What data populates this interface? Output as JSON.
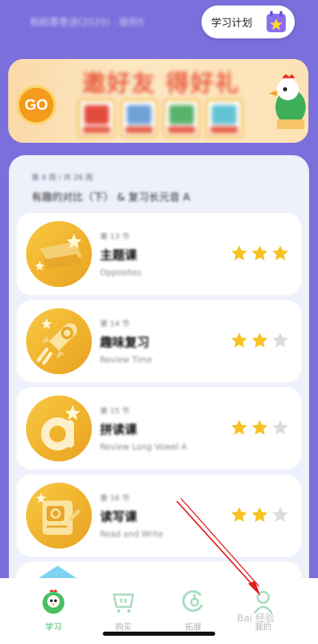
{
  "header": {
    "blurred_text": "稻稻要患迹(2020) · 级别5",
    "plan_button_label": "学习计划"
  },
  "banner": {
    "go_label": "GO",
    "title": "邀好友 得好礼"
  },
  "unit": {
    "meta": "第 4 周 / 共 26 周",
    "title": "有趣的对比（下） & 复习长元音 A"
  },
  "lessons": [
    {
      "index": "第 13 节",
      "title": "主题课",
      "subtitle": "Opposites",
      "stars": 3
    },
    {
      "index": "第 14 节",
      "title": "趣味复习",
      "subtitle": "Review Time",
      "stars": 2
    },
    {
      "index": "第 15 节",
      "title": "拼读课",
      "subtitle": "Review Long Vowel A",
      "stars": 2
    },
    {
      "index": "第 16 节",
      "title": "读写课",
      "subtitle": "Read and Write",
      "stars": 2
    }
  ],
  "nav": {
    "items": [
      {
        "label": "学习",
        "icon": "bird-mascot-icon",
        "active": true
      },
      {
        "label": "购买",
        "icon": "cart-icon",
        "active": false
      },
      {
        "label": "拓展",
        "icon": "expand-icon",
        "active": false
      },
      {
        "label": "我的",
        "icon": "profile-icon",
        "active": false
      }
    ]
  },
  "watermark": "Bai 经验",
  "colors": {
    "background": "#7b6fdc",
    "star_on": "#f7c324",
    "star_off": "#dcdcdc",
    "active_nav": "#3ebc6a",
    "arrow": "#e02020"
  }
}
